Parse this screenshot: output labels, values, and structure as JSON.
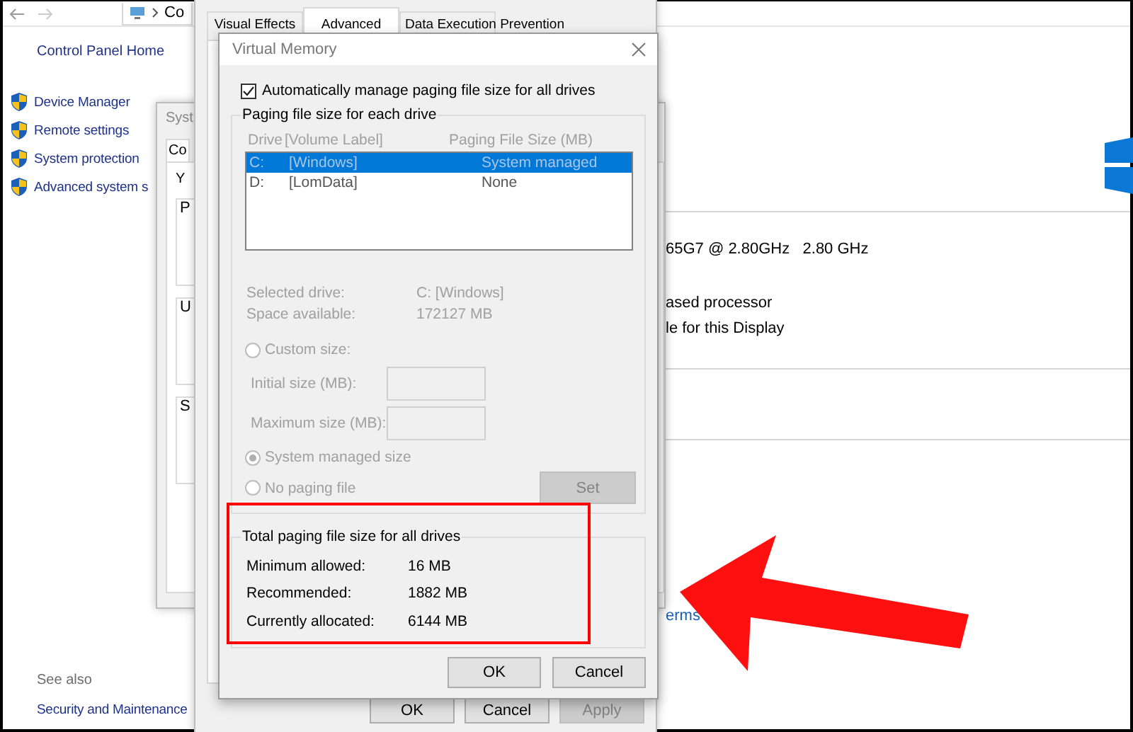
{
  "control_panel": {
    "address_text": "Co",
    "sidebar": {
      "home": "Control Panel Home",
      "items": [
        "Device Manager",
        "Remote settings",
        "System protection",
        "Advanced system s"
      ]
    },
    "see_also": {
      "heading": "See also",
      "items": [
        "Security and Maintenance"
      ]
    },
    "system_info": [
      "65G7 @ 2.80GHz   2.80 GHz",
      "ased processor",
      "le for this Display"
    ],
    "link": "erms"
  },
  "system_properties": {
    "title": "Syst",
    "tab": "Co",
    "intro": "Y",
    "groups": [
      "P",
      "U",
      "S"
    ]
  },
  "performance_options": {
    "tabs": [
      {
        "label": "Visual Effects",
        "selected": false
      },
      {
        "label": "Advanced",
        "selected": true
      },
      {
        "label": "Data Execution Prevention",
        "selected": false
      }
    ],
    "buttons": [
      {
        "label": "OK",
        "disabled": false
      },
      {
        "label": "Cancel",
        "disabled": false
      },
      {
        "label": "Apply",
        "disabled": true
      }
    ]
  },
  "virtual_memory": {
    "title": "Virtual Memory",
    "auto_manage": {
      "label": "Automatically manage paging file size for all drives",
      "checked": true
    },
    "per_drive": {
      "title": "Paging file size for each drive",
      "columns": [
        "Drive",
        "[Volume Label]",
        "Paging File Size (MB)"
      ],
      "drives": [
        {
          "drive": "C:",
          "label": "[Windows]",
          "size": "System managed",
          "selected": true
        },
        {
          "drive": "D:",
          "label": "[LomData]",
          "size": "None",
          "selected": false
        }
      ],
      "info": [
        {
          "label": "Selected drive:",
          "value": "C:  [Windows]"
        },
        {
          "label": "Space available:",
          "value": "172127 MB"
        }
      ],
      "options": [
        {
          "kind": "radio",
          "label": "Custom size:",
          "selected": false
        },
        {
          "kind": "field",
          "label": "Initial size (MB):"
        },
        {
          "kind": "field",
          "label": "Maximum size (MB):"
        },
        {
          "kind": "radio",
          "label": "System managed size",
          "selected": true
        },
        {
          "kind": "radio",
          "label": "No paging file",
          "selected": false
        }
      ],
      "set_button": "Set"
    },
    "totals": {
      "title": "Total paging file size for all drives",
      "rows": [
        {
          "label": "Minimum allowed:",
          "value": "16 MB"
        },
        {
          "label": "Recommended:",
          "value": "1882 MB"
        },
        {
          "label": "Currently allocated:",
          "value": "6144 MB"
        }
      ]
    },
    "buttons": [
      "OK",
      "Cancel"
    ]
  }
}
